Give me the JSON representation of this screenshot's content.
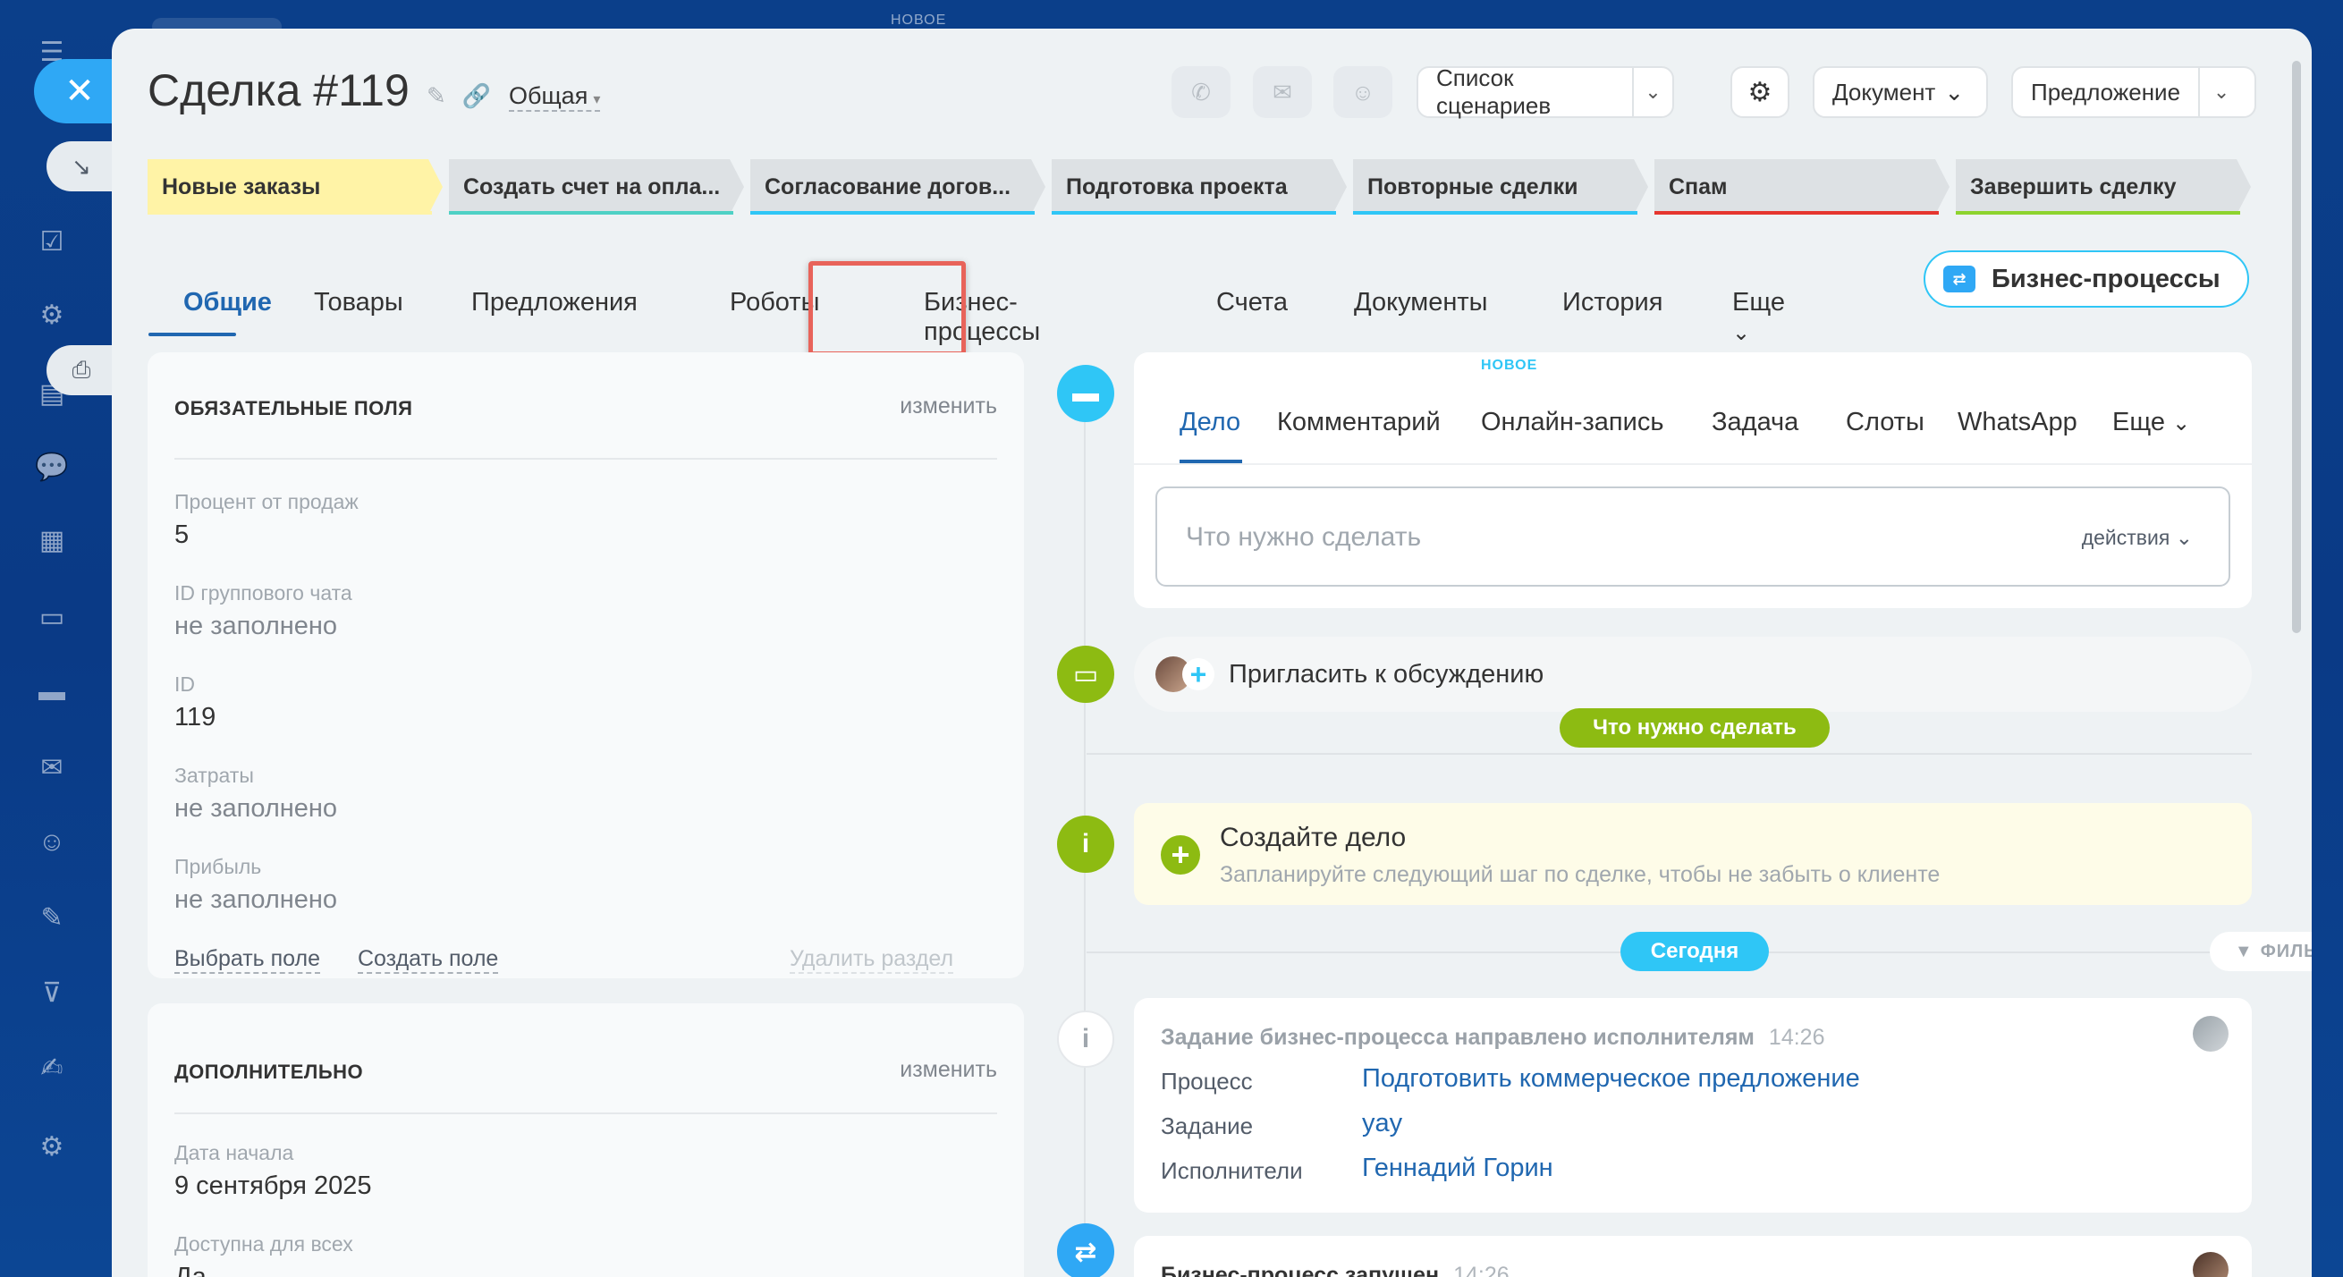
{
  "top_badge": "НОВОЕ",
  "sidebar": {
    "close_icon": "close-icon",
    "icons": [
      "menu-icon",
      "home-icon",
      "tasks-icon",
      "crm-icon",
      "docs-icon",
      "chat-icon",
      "calendar-icon",
      "files-icon",
      "cards-icon",
      "mail-icon",
      "contacts-icon",
      "pen-icon",
      "filter-icon",
      "sign-icon",
      "gear-icon"
    ]
  },
  "header": {
    "title": "Сделка #119",
    "category": "Общая",
    "scenarios": "Список сценариев",
    "document": "Документ",
    "offer": "Предложение"
  },
  "stages": [
    {
      "label": "Новые заказы",
      "color": "#fff3a6",
      "line": "#fff3a6"
    },
    {
      "label": "Создать счет на опла...",
      "color": "#dde1e4",
      "line": "#4fd1c5"
    },
    {
      "label": "Согласование догов...",
      "color": "#dde1e4",
      "line": "#2fc6f6"
    },
    {
      "label": "Подготовка проекта",
      "color": "#dde1e4",
      "line": "#2fc6f6"
    },
    {
      "label": "Повторные сделки",
      "color": "#dde1e4",
      "line": "#2fc6f6"
    },
    {
      "label": "Спам",
      "color": "#dde1e4",
      "line": "#e5362f"
    },
    {
      "label": "Завершить сделку",
      "color": "#dde1e4",
      "line": "#8dd32e"
    }
  ],
  "tabs": {
    "general": "Общие",
    "products": "Товары",
    "offers": "Предложения",
    "robots": "Роботы",
    "bp": "Бизнес-процессы",
    "invoices": "Счета",
    "documents": "Документы",
    "history": "История",
    "more": "Еще",
    "bp_button": "Бизнес-процессы"
  },
  "required": {
    "title": "ОБЯЗАТЕЛЬНЫЕ ПОЛЯ",
    "edit": "изменить",
    "fields": [
      {
        "label": "Процент от продаж",
        "value": "5"
      },
      {
        "label": "ID группового чата",
        "value": "не заполнено"
      },
      {
        "label": "ID",
        "value": "119"
      },
      {
        "label": "Затраты",
        "value": "не заполнено"
      },
      {
        "label": "Прибыль",
        "value": "не заполнено"
      }
    ],
    "select_field": "Выбрать поле",
    "create_field": "Создать поле",
    "delete_section": "Удалить раздел"
  },
  "additional": {
    "title": "ДОПОЛНИТЕЛЬНО",
    "edit": "изменить",
    "fields": [
      {
        "label": "Дата начала",
        "value": "9 сентября 2025"
      },
      {
        "label": "Доступна для всех",
        "value": "Да"
      }
    ]
  },
  "activity": {
    "tabs": [
      "Дело",
      "Комментарий",
      "Онлайн-запись",
      "Задача",
      "Слоты",
      "WhatsApp",
      "Еще"
    ],
    "new_badge": "НОВОЕ",
    "placeholder": "Что нужно сделать",
    "actions": "действия"
  },
  "timeline": {
    "invite": "Пригласить к обсуждению",
    "todo_pill": "Что нужно сделать",
    "create_title": "Создайте дело",
    "create_sub": "Запланируйте следующий шаг по сделке, чтобы не забыть о клиенте",
    "today_pill": "Сегодня",
    "filter": "ФИЛЬТР",
    "event1": {
      "title": "Задание бизнес-процесса направлено исполнителям",
      "time": "14:26",
      "rows": [
        {
          "key": "Процесс",
          "value": "Подготовить коммерческое предложение"
        },
        {
          "key": "Задание",
          "value": "yay"
        },
        {
          "key": "Исполнители",
          "value": "Геннадий Горин"
        }
      ]
    },
    "event2": {
      "title": "Бизнес-процесс запущен",
      "time": "14:26"
    }
  }
}
